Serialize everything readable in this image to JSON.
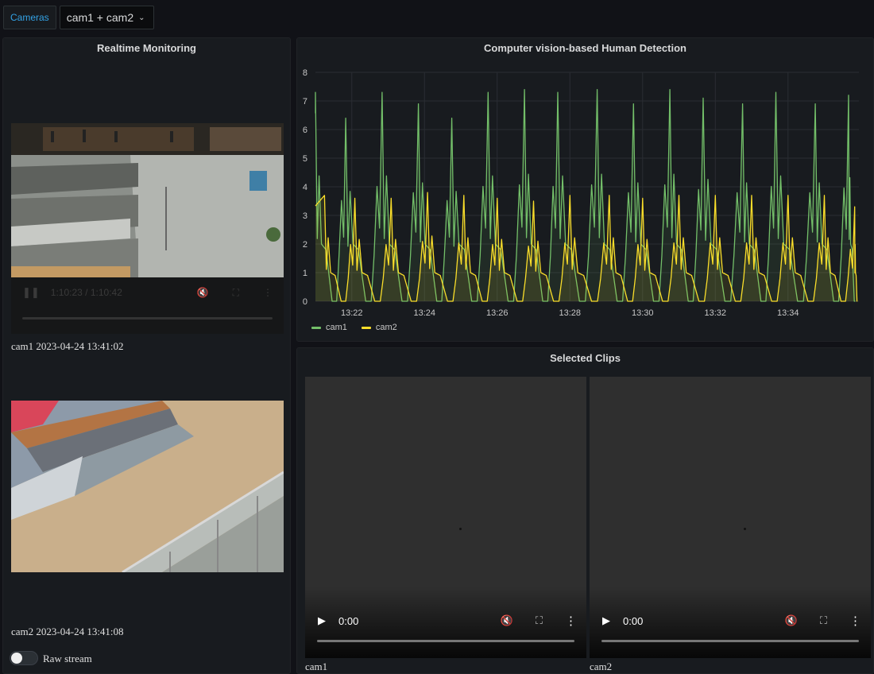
{
  "toolbar": {
    "variable_label": "Cameras",
    "variable_value": "cam1 + cam2"
  },
  "live_panel": {
    "title": "Realtime Monitoring",
    "cam1": {
      "time_display": "1:10:23 / 1:10:42",
      "caption_name": "cam1",
      "caption_timestamp": "2023-04-24 13:41:02"
    },
    "cam2": {
      "caption_name": "cam2",
      "caption_timestamp": "2023-04-24 13:41:08"
    },
    "toggle_label": "Raw stream",
    "toggle_on": false
  },
  "chart_panel": {
    "title": "Computer vision-based Human Detection"
  },
  "clips_panel": {
    "title": "Selected Clips",
    "clips": [
      {
        "time": "0:00",
        "label": "cam1"
      },
      {
        "time": "0:00",
        "label": "cam2"
      }
    ]
  },
  "colors": {
    "cam1": "#73bf69",
    "cam2": "#fade2a"
  },
  "icons": {
    "play": "play-icon",
    "pause": "pause-icon",
    "mute": "mute-icon",
    "fullscreen": "fullscreen-icon",
    "more": "more-vertical-icon"
  },
  "chart_data": {
    "type": "line",
    "title": "Computer vision-based Human Detection",
    "xlabel": "",
    "ylabel": "",
    "ylim": [
      0,
      8
    ],
    "yticks": [
      "0",
      "1",
      "2",
      "3",
      "4",
      "5",
      "6",
      "7",
      "8"
    ],
    "xticks": [
      "13:22",
      "13:24",
      "13:26",
      "13:28",
      "13:30",
      "13:32",
      "13:34"
    ],
    "xlim": [
      "13:21",
      "13:35:57"
    ],
    "grid": true,
    "legend_position": "bottom-left",
    "series": [
      {
        "name": "cam1",
        "peak_times": [
          "13:21:00",
          "13:21:50",
          "13:22:50",
          "13:23:50",
          "13:24:45",
          "13:25:45",
          "13:26:45",
          "13:27:40",
          "13:28:45",
          "13:29:45",
          "13:30:45",
          "13:31:40",
          "13:32:45",
          "13:33:40",
          "13:34:45",
          "13:35:40"
        ],
        "peak_values": [
          7.3,
          6.4,
          7.3,
          6.9,
          6.4,
          7.3,
          7.4,
          7.3,
          7.4,
          6.9,
          7.4,
          7.1,
          6.9,
          7.3,
          6.9,
          7.2
        ],
        "trough_value": 0,
        "baseline_value": 2
      },
      {
        "name": "cam2",
        "peak_times": [
          "13:21:15",
          "13:22:05",
          "13:23:05",
          "13:24:05",
          "13:25:05",
          "13:26:00",
          "13:27:00",
          "13:28:00",
          "13:29:05",
          "13:30:00",
          "13:31:00",
          "13:32:00",
          "13:33:00",
          "13:34:00",
          "13:35:00",
          "13:35:50"
        ],
        "peak_values": [
          3.7,
          3.6,
          3.6,
          3.8,
          3.7,
          3.6,
          3.5,
          3.7,
          3.7,
          3.6,
          3.7,
          3.7,
          3.7,
          3.7,
          3.7,
          3.3
        ],
        "trough_value": 0,
        "baseline_value": 1
      }
    ]
  }
}
